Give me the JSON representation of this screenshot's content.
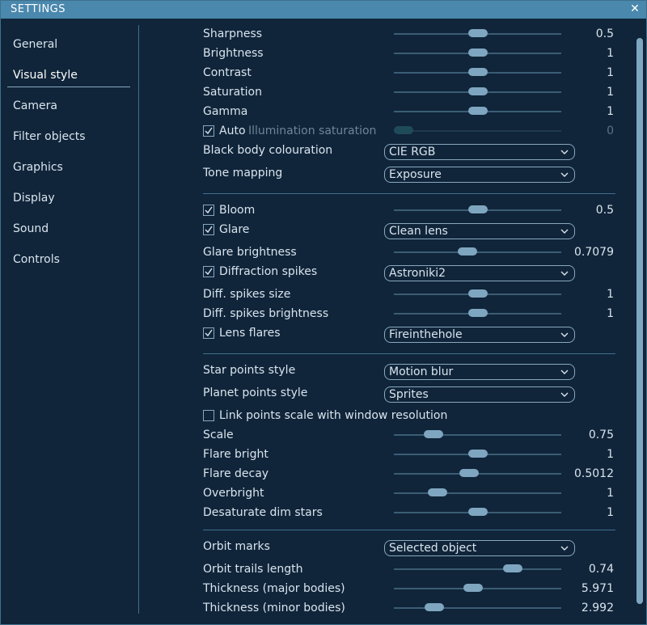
{
  "window": {
    "title": "SETTINGS",
    "close_glyph": "✕"
  },
  "sidebar": {
    "items": [
      {
        "label": "General"
      },
      {
        "label": "Visual style",
        "active": true
      },
      {
        "label": "Camera"
      },
      {
        "label": "Filter objects"
      },
      {
        "label": "Graphics"
      },
      {
        "label": "Display"
      },
      {
        "label": "Sound"
      },
      {
        "label": "Controls"
      }
    ]
  },
  "section1": {
    "sharpness": {
      "label": "Sharpness",
      "value": "0.5",
      "fraction": 0.5
    },
    "brightness": {
      "label": "Brightness",
      "value": "1",
      "fraction": 0.5
    },
    "contrast": {
      "label": "Contrast",
      "value": "1",
      "fraction": 0.5
    },
    "saturation": {
      "label": "Saturation",
      "value": "1",
      "fraction": 0.5
    },
    "gamma": {
      "label": "Gamma",
      "value": "1",
      "fraction": 0.5
    },
    "auto": {
      "label": "Auto",
      "checked": true
    },
    "illumination": {
      "label": "Illumination saturation",
      "value": "0",
      "fraction": 0.0
    },
    "black_body": {
      "label": "Black body colouration",
      "selected": "CIE RGB"
    },
    "tone_mapping": {
      "label": "Tone mapping",
      "selected": "Exposure"
    }
  },
  "section2": {
    "bloom": {
      "label": "Bloom",
      "checked": true,
      "value": "0.5",
      "fraction": 0.5
    },
    "glare": {
      "label": "Glare",
      "checked": true,
      "selected": "Clean lens"
    },
    "glare_brightness": {
      "label": "Glare brightness",
      "value": "0.7079",
      "fraction": 0.43
    },
    "diffraction": {
      "label": "Diffraction spikes",
      "checked": true,
      "selected": "Astroniki2"
    },
    "diff_size": {
      "label": "Diff. spikes size",
      "value": "1",
      "fraction": 0.5
    },
    "diff_brightness": {
      "label": "Diff. spikes brightness",
      "value": "1",
      "fraction": 0.5
    },
    "lens_flares": {
      "label": "Lens flares",
      "checked": true,
      "selected": "Fireinthehole"
    }
  },
  "section3": {
    "star_points": {
      "label": "Star points style",
      "selected": "Motion blur"
    },
    "planet_points": {
      "label": "Planet points style",
      "selected": "Sprites"
    },
    "link_scale": {
      "label": "Link points scale with window resolution",
      "checked": false
    },
    "scale": {
      "label": "Scale",
      "value": "0.75",
      "fraction": 0.2
    },
    "flare_bright": {
      "label": "Flare bright",
      "value": "1",
      "fraction": 0.5
    },
    "flare_decay": {
      "label": "Flare decay",
      "value": "0.5012",
      "fraction": 0.44
    },
    "overbright": {
      "label": "Overbright",
      "value": "1",
      "fraction": 0.23
    },
    "desaturate": {
      "label": "Desaturate dim stars",
      "value": "1",
      "fraction": 0.5
    }
  },
  "section4": {
    "orbit_marks": {
      "label": "Orbit marks",
      "selected": "Selected object"
    },
    "orbit_trails": {
      "label": "Orbit trails length",
      "value": "0.74",
      "fraction": 0.74
    },
    "thickness_major": {
      "label": "Thickness (major bodies)",
      "value": "5.971",
      "fraction": 0.47
    },
    "thickness_minor": {
      "label": "Thickness (minor bodies)",
      "value": "2.992",
      "fraction": 0.21
    }
  },
  "colors": {
    "accent": "#4a88ad",
    "background": "#10253a",
    "thumb": "#7fa6c0"
  },
  "scroll": {
    "fraction": 0.0
  }
}
